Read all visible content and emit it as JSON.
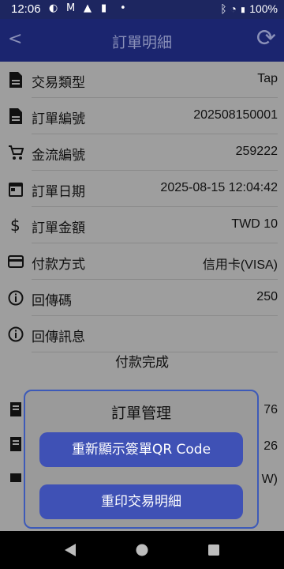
{
  "status": {
    "time": "12:06",
    "battery": "100%"
  },
  "appbar": {
    "title": "訂單明細",
    "back_icon": "back-arrow-icon",
    "refresh_icon": "refresh-icon"
  },
  "rows": [
    {
      "label": "交易類型",
      "value": "Tap",
      "icon": "document-icon"
    },
    {
      "label": "訂單編號",
      "value": "202508150001",
      "icon": "document-icon"
    },
    {
      "label": "金流編號",
      "value": "259222",
      "icon": "cart-icon"
    },
    {
      "label": "訂單日期",
      "value": "2025-08-15 12:04:42",
      "icon": "calendar-icon"
    },
    {
      "label": "訂單金額",
      "value": "TWD 10",
      "icon": "dollar-icon"
    },
    {
      "label": "付款方式",
      "value": "信用卡(VISA)",
      "icon": "credit-card-icon"
    },
    {
      "label": "回傳碼",
      "value": "250",
      "icon": "info-icon"
    },
    {
      "label": "回傳訊息",
      "value": "",
      "icon": "info-icon"
    }
  ],
  "payment_status": "付款完成",
  "under_values": [
    "76",
    "26",
    "W)"
  ],
  "dialog": {
    "title": "訂單管理",
    "btn_qr": "重新顯示簽單QR Code",
    "btn_reprint": "重印交易明細"
  }
}
